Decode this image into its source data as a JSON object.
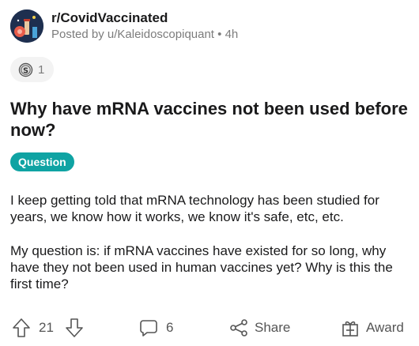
{
  "post": {
    "community": "r/CovidVaccinated",
    "posted_by": "Posted by u/Kaleidoscopiquant • 4h",
    "award_count": "1",
    "title": "Why have mRNA vaccines not been used before now?",
    "flair": "Question",
    "body": [
      "I keep getting told that mRNA technology has been studied for years, we know how it works, we know it's safe, etc, etc.",
      "My question is: if mRNA vaccines have existed for so long, why have they not been used in human vaccines yet? Why is this the first time?"
    ]
  },
  "actions": {
    "score": "21",
    "comments": "6",
    "share_label": "Share",
    "award_label": "Award"
  },
  "colors": {
    "flair_bg": "#0fa3a3",
    "avatar_bg": "#1e2f4f",
    "muted_text": "#7c7c7c"
  },
  "icons": [
    "community-avatar",
    "silver-coin-icon",
    "upvote-arrow-icon",
    "downvote-arrow-icon",
    "comment-bubble-icon",
    "share-icon",
    "gift-icon"
  ]
}
